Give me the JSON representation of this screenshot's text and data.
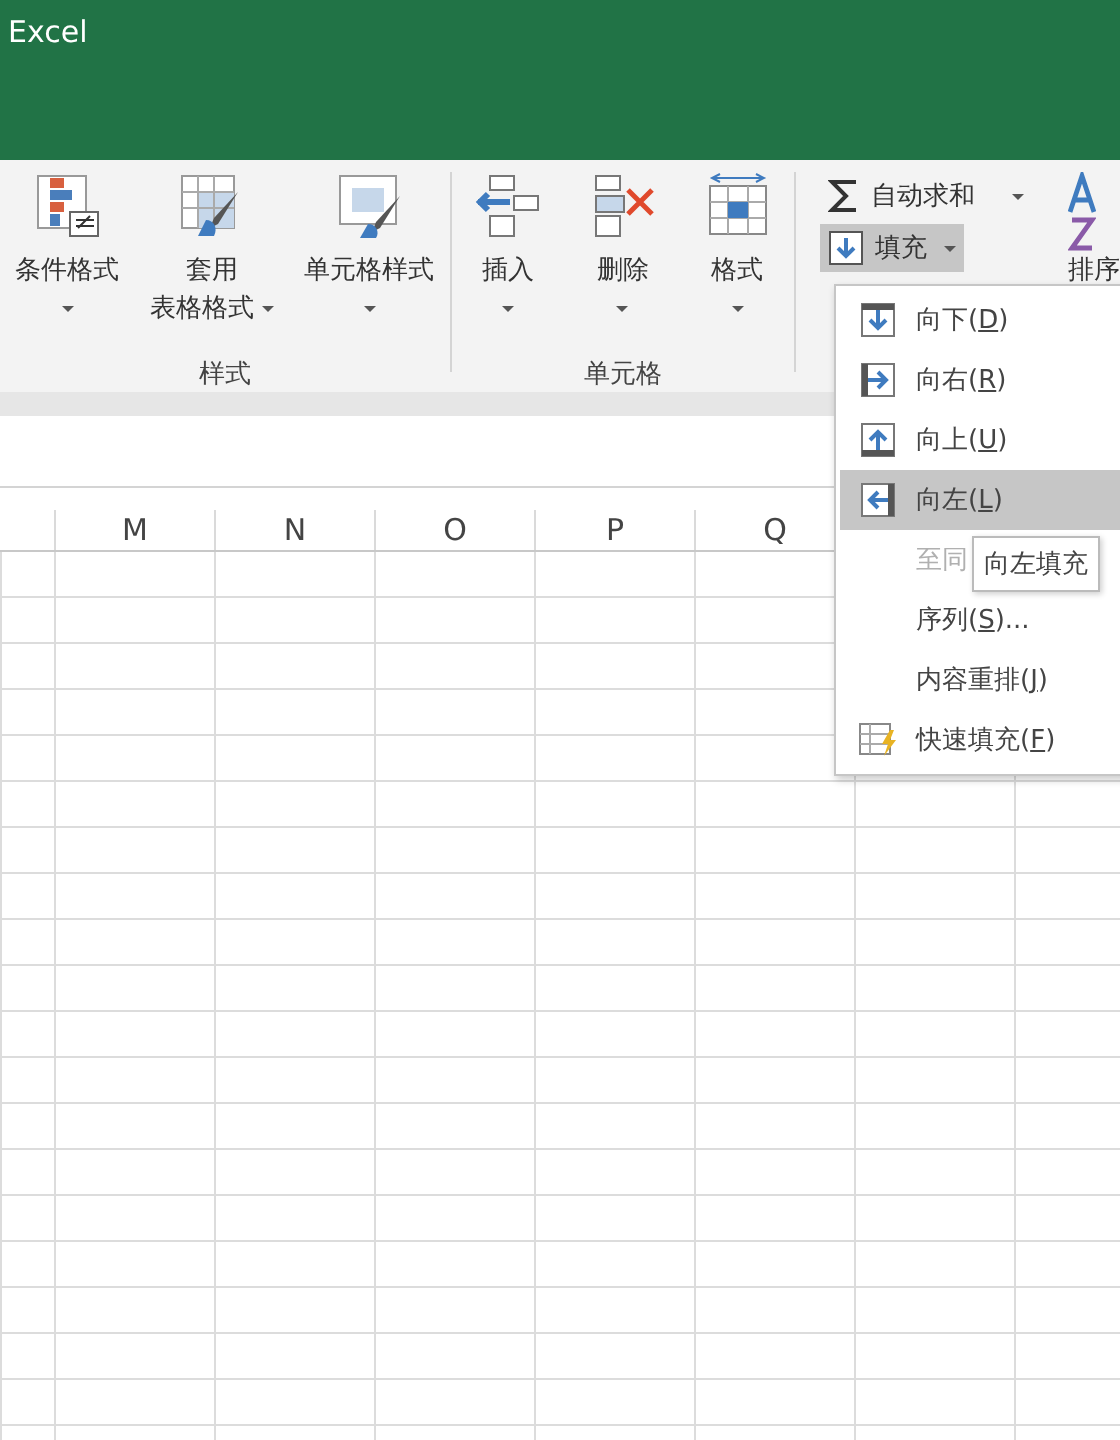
{
  "app": {
    "title": "Excel"
  },
  "ribbon": {
    "groups": [
      {
        "label": "样式",
        "buttons": [
          {
            "kind": "conditional",
            "lines": [
              "条件格式"
            ],
            "dropdown": true
          },
          {
            "kind": "table",
            "lines": [
              "套用",
              "表格格式"
            ],
            "dropdown": true
          },
          {
            "kind": "cellstyle",
            "lines": [
              "单元格样式"
            ],
            "dropdown": true
          }
        ]
      },
      {
        "label": "单元格",
        "buttons": [
          {
            "kind": "insert",
            "lines": [
              "插入"
            ],
            "dropdown": true
          },
          {
            "kind": "delete",
            "lines": [
              "删除"
            ],
            "dropdown": true
          },
          {
            "kind": "format",
            "lines": [
              "格式"
            ],
            "dropdown": true
          }
        ]
      }
    ],
    "editing": {
      "autosum": {
        "label": "自动求和",
        "dropdown": true
      },
      "fill": {
        "label": "填充",
        "pressed": true,
        "dropdown": true
      },
      "sort": {
        "label": "排序"
      }
    }
  },
  "columns": [
    "M",
    "N",
    "O",
    "P",
    "Q"
  ],
  "fill_menu": {
    "items": [
      {
        "kind": "down",
        "before": "向下(",
        "accel": "D",
        "after": ")",
        "selected": false,
        "disabled": false
      },
      {
        "kind": "right",
        "before": "向右(",
        "accel": "R",
        "after": ")",
        "selected": false,
        "disabled": false
      },
      {
        "kind": "up",
        "before": "向上(",
        "accel": "U",
        "after": ")",
        "selected": false,
        "disabled": false
      },
      {
        "kind": "left",
        "before": "向左(",
        "accel": "L",
        "after": ")",
        "selected": true,
        "disabled": false
      },
      {
        "kind": "plain",
        "before": "至同",
        "selected": false,
        "disabled": true
      },
      {
        "kind": "plain",
        "before": "序列(",
        "accel": "S",
        "after": ")...",
        "selected": false,
        "disabled": false
      },
      {
        "kind": "plain",
        "before": "内容重排(",
        "accel": "J",
        "after": ")",
        "selected": false,
        "disabled": false
      },
      {
        "kind": "flash",
        "before": "快速填充(",
        "accel": "F",
        "after": ")",
        "selected": false,
        "disabled": false
      }
    ]
  },
  "tooltip": "向左填充"
}
